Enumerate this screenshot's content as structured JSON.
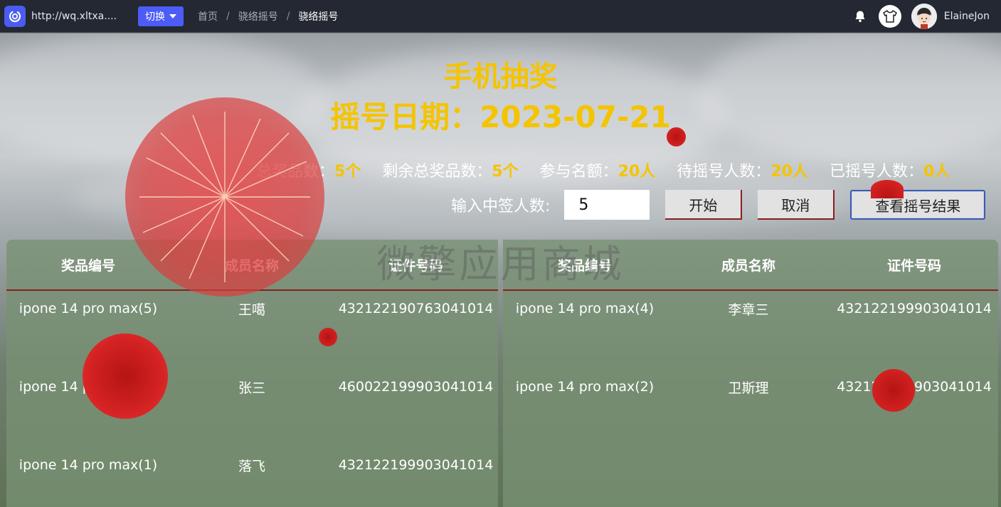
{
  "topbar": {
    "url": "http://wq.xltxa....",
    "switch_label": "切换",
    "breadcrumbs": [
      "首页",
      "骁络摇号",
      "骁络摇号"
    ],
    "username": "ElaineJon"
  },
  "lottery": {
    "title": "手机抽奖",
    "date_label": "摇号日期：",
    "date_value": "2023-07-21",
    "stats": [
      {
        "label": "总奖品数：",
        "value": "5个"
      },
      {
        "label": "剩余总奖品数：",
        "value": "5个"
      },
      {
        "label": "参与名额：",
        "value": "20人"
      },
      {
        "label": "待摇号人数：",
        "value": "20人"
      },
      {
        "label": "已摇号人数：",
        "value": "0人"
      }
    ],
    "input_label": "输入中签人数:",
    "input_value": "5",
    "start_label": "开始",
    "cancel_label": "取消",
    "result_label": "查看摇号结果"
  },
  "watermark": "微擎应用商城",
  "table_left": {
    "columns": [
      "奖品编号",
      "成员名称",
      "证件号码"
    ],
    "rows": [
      [
        "ipone 14 pro max(5)",
        "王噶",
        "432122190763041014"
      ],
      [
        "ipone 14 pro max(3)",
        "张三",
        "460022199903041014"
      ],
      [
        "ipone 14 pro max(1)",
        "落飞",
        "432122199903041014"
      ]
    ]
  },
  "table_right": {
    "columns": [
      "奖品编号",
      "成员名称",
      "证件号码"
    ],
    "rows": [
      [
        "ipone 14 pro max(4)",
        "李章三",
        "432122199903041014"
      ],
      [
        "ipone 14 pro max(2)",
        "卫斯理",
        "432122199903041014"
      ]
    ]
  },
  "colors": {
    "accent_yellow": "#f4c400",
    "topbar_bg": "#232832",
    "switch_btn": "#4c5cf6",
    "divider_red": "#8b1d1d"
  }
}
